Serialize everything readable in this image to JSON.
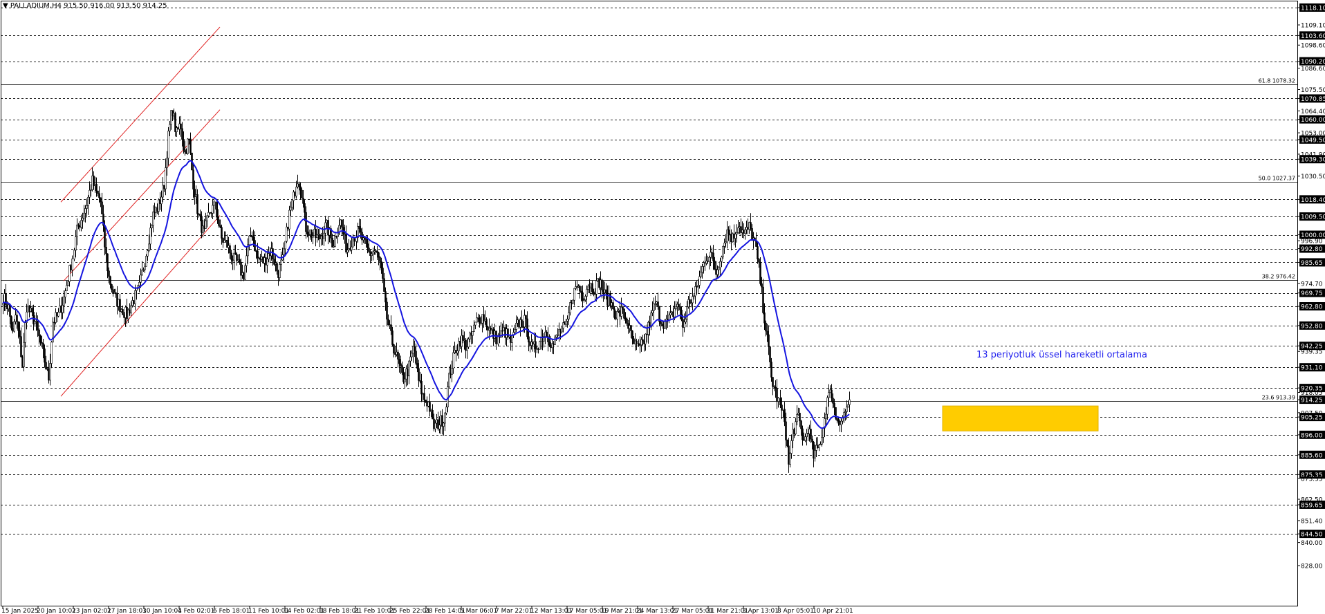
{
  "header": {
    "symbol_info": "▼ PALLADIUM,H4  915.50 916.00 913.50 914.25"
  },
  "annotation": {
    "text": "13 periyotluk üssel hareketli ortalama"
  },
  "chart_data": {
    "type": "candlestick",
    "title": "",
    "ylim": [
      826.5,
      1122.0
    ],
    "y_axis_ticks": [
      1118.1,
      1109.1,
      1103.6,
      1098.6,
      1090.2,
      1086.6,
      1075.5,
      1070.85,
      1064.4,
      1060.0,
      1053.0,
      1049.5,
      1041.9,
      1039.3,
      1030.5,
      1018.4,
      1009.5,
      1000.0,
      996.9,
      992.8,
      985.65,
      974.7,
      969.75,
      962.8,
      952.8,
      942.25,
      939.35,
      931.1,
      920.35,
      918.05,
      914.25,
      907.5,
      905.25,
      896.0,
      885.6,
      875.35,
      873.35,
      862.5,
      859.65,
      851.4,
      844.5,
      840.0,
      828.0
    ],
    "y_tick_labels": [
      "1118.10",
      "1109.10",
      "1103.60",
      "1098.60",
      "1090.20",
      "1086.60",
      "1075.50",
      "1070.85",
      "1064.40",
      "1060.00",
      "1053.00",
      "1049.50",
      "1041.90",
      "1039.30",
      "1030.50",
      "1018.40",
      "1009.50",
      "1000.00",
      "996.90",
      "992.80",
      "985.65",
      "974.70",
      "969.75",
      "962.80",
      "952.80",
      "942.25",
      "939.35",
      "931.10",
      "920.35",
      "918.05",
      "914.25",
      "907.50",
      "905.25",
      "896.00",
      "885.60",
      "875.35",
      "873.35",
      "862.50",
      "859.65",
      "851.40",
      "844.50",
      "840.00",
      "828.00"
    ],
    "boxed_levels": [
      1118.1,
      1103.6,
      1090.2,
      1070.85,
      1060.0,
      1049.5,
      1039.3,
      1018.4,
      1009.5,
      1000.0,
      992.8,
      985.65,
      969.75,
      962.8,
      952.8,
      942.25,
      931.1,
      920.35,
      914.25,
      905.25,
      896.0,
      885.6,
      875.35,
      859.65,
      844.5
    ],
    "dashed_levels": [
      1118.1,
      1103.6,
      1090.2,
      1070.85,
      1060.0,
      1049.5,
      1039.3,
      1018.4,
      1009.5,
      1000.0,
      992.8,
      985.65,
      969.75,
      962.8,
      952.8,
      942.25,
      931.1,
      920.35,
      905.25,
      896.0,
      885.6,
      875.35,
      859.65,
      844.5
    ],
    "fib_levels": [
      {
        "label": "61.8 1078.32",
        "value": 1078.32
      },
      {
        "label": "50.0 1027.37",
        "value": 1027.37
      },
      {
        "label": "38.2 976.42",
        "value": 976.42
      },
      {
        "label": "23.6 913.39",
        "value": 913.39
      }
    ],
    "x_tick_labels": [
      "15 Jan 2025",
      "20 Jan 10:01",
      "23 Jan 02:01",
      "27 Jan 18:01",
      "30 Jan 10:01",
      "4 Feb 02:01",
      "6 Feb 18:01",
      "11 Feb 10:01",
      "14 Feb 02:01",
      "18 Feb 18:01",
      "21 Feb 10:01",
      "25 Feb 22:01",
      "28 Feb 14:01",
      "5 Mar 06:01",
      "7 Mar 22:01",
      "12 Mar 13:01",
      "17 Mar 05:01",
      "19 Mar 21:01",
      "24 Mar 13:01",
      "27 Mar 05:01",
      "31 Mar 21:01",
      "3 Apr 13:01",
      "8 Apr 05:01",
      "10 Apr 21:01"
    ],
    "price_path": [
      [
        0,
        968
      ],
      [
        8,
        962
      ],
      [
        14,
        948
      ],
      [
        18,
        958
      ],
      [
        24,
        945
      ],
      [
        28,
        932
      ],
      [
        34,
        963
      ],
      [
        46,
        955
      ],
      [
        58,
        938
      ],
      [
        66,
        925
      ],
      [
        72,
        955
      ],
      [
        80,
        958
      ],
      [
        88,
        967
      ],
      [
        100,
        988
      ],
      [
        106,
        1002
      ],
      [
        112,
        1008
      ],
      [
        120,
        1016
      ],
      [
        128,
        1028
      ],
      [
        134,
        1022
      ],
      [
        140,
        1018
      ],
      [
        146,
        995
      ],
      [
        152,
        978
      ],
      [
        160,
        968
      ],
      [
        170,
        962
      ],
      [
        178,
        958
      ],
      [
        186,
        965
      ],
      [
        196,
        972
      ],
      [
        206,
        990
      ],
      [
        216,
        1010
      ],
      [
        224,
        1015
      ],
      [
        232,
        1025
      ],
      [
        238,
        1050
      ],
      [
        244,
        1066
      ],
      [
        250,
        1052
      ],
      [
        256,
        1058
      ],
      [
        262,
        1042
      ],
      [
        268,
        1050
      ],
      [
        274,
        1028
      ],
      [
        282,
        1010
      ],
      [
        290,
        1000
      ],
      [
        298,
        1012
      ],
      [
        306,
        1015
      ],
      [
        314,
        998
      ],
      [
        322,
        995
      ],
      [
        330,
        988
      ],
      [
        338,
        985
      ],
      [
        346,
        978
      ],
      [
        352,
        992
      ],
      [
        358,
        1002
      ],
      [
        366,
        988
      ],
      [
        376,
        986
      ],
      [
        386,
        992
      ],
      [
        396,
        980
      ],
      [
        404,
        988
      ],
      [
        412,
        1010
      ],
      [
        418,
        1018
      ],
      [
        424,
        1030
      ],
      [
        430,
        1025
      ],
      [
        436,
        1004
      ],
      [
        446,
        1000
      ],
      [
        456,
        998
      ],
      [
        466,
        1005
      ],
      [
        476,
        995
      ],
      [
        486,
        1008
      ],
      [
        496,
        992
      ],
      [
        504,
        998
      ],
      [
        512,
        1002
      ],
      [
        520,
        995
      ],
      [
        528,
        990
      ],
      [
        536,
        992
      ],
      [
        544,
        984
      ],
      [
        552,
        958
      ],
      [
        560,
        945
      ],
      [
        568,
        935
      ],
      [
        576,
        925
      ],
      [
        584,
        930
      ],
      [
        592,
        942
      ],
      [
        598,
        925
      ],
      [
        606,
        915
      ],
      [
        614,
        912
      ],
      [
        620,
        900
      ],
      [
        628,
        902
      ],
      [
        636,
        905
      ],
      [
        644,
        928
      ],
      [
        652,
        940
      ],
      [
        660,
        946
      ],
      [
        668,
        942
      ],
      [
        676,
        948
      ],
      [
        684,
        956
      ],
      [
        692,
        958
      ],
      [
        702,
        950
      ],
      [
        712,
        946
      ],
      [
        722,
        950
      ],
      [
        732,
        944
      ],
      [
        742,
        954
      ],
      [
        752,
        955
      ],
      [
        762,
        940
      ],
      [
        772,
        944
      ],
      [
        782,
        950
      ],
      [
        792,
        942
      ],
      [
        802,
        950
      ],
      [
        812,
        952
      ],
      [
        820,
        968
      ],
      [
        828,
        974
      ],
      [
        836,
        968
      ],
      [
        844,
        975
      ],
      [
        852,
        972
      ],
      [
        860,
        976
      ],
      [
        868,
        968
      ],
      [
        876,
        965
      ],
      [
        884,
        958
      ],
      [
        892,
        960
      ],
      [
        900,
        955
      ],
      [
        908,
        944
      ],
      [
        916,
        940
      ],
      [
        924,
        945
      ],
      [
        932,
        955
      ],
      [
        940,
        965
      ],
      [
        948,
        955
      ],
      [
        956,
        954
      ],
      [
        964,
        958
      ],
      [
        972,
        965
      ],
      [
        980,
        952
      ],
      [
        988,
        965
      ],
      [
        996,
        968
      ],
      [
        1004,
        978
      ],
      [
        1012,
        988
      ],
      [
        1020,
        990
      ],
      [
        1028,
        980
      ],
      [
        1036,
        992
      ],
      [
        1044,
        1002
      ],
      [
        1052,
        998
      ],
      [
        1060,
        1006
      ],
      [
        1068,
        1000
      ],
      [
        1076,
        1004
      ],
      [
        1084,
        995
      ],
      [
        1090,
        982
      ],
      [
        1096,
        962
      ],
      [
        1102,
        945
      ],
      [
        1108,
        925
      ],
      [
        1114,
        918
      ],
      [
        1120,
        910
      ],
      [
        1126,
        904
      ],
      [
        1132,
        880
      ],
      [
        1138,
        898
      ],
      [
        1146,
        905
      ],
      [
        1154,
        892
      ],
      [
        1160,
        900
      ],
      [
        1168,
        885
      ],
      [
        1176,
        890
      ],
      [
        1182,
        900
      ],
      [
        1188,
        915
      ],
      [
        1194,
        918
      ],
      [
        1200,
        905
      ],
      [
        1208,
        904
      ],
      [
        1214,
        908
      ],
      [
        1220,
        914.25
      ]
    ]
  }
}
